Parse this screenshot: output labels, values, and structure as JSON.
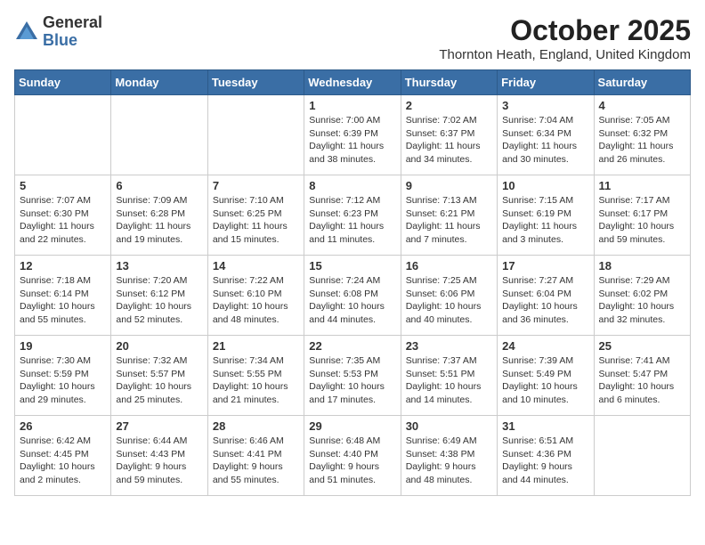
{
  "header": {
    "logo_general": "General",
    "logo_blue": "Blue",
    "month_title": "October 2025",
    "location": "Thornton Heath, England, United Kingdom"
  },
  "days_of_week": [
    "Sunday",
    "Monday",
    "Tuesday",
    "Wednesday",
    "Thursday",
    "Friday",
    "Saturday"
  ],
  "weeks": [
    [
      {
        "day": "",
        "empty": true
      },
      {
        "day": "",
        "empty": true
      },
      {
        "day": "",
        "empty": true
      },
      {
        "day": "1",
        "sunrise": "Sunrise: 7:00 AM",
        "sunset": "Sunset: 6:39 PM",
        "daylight": "Daylight: 11 hours and 38 minutes."
      },
      {
        "day": "2",
        "sunrise": "Sunrise: 7:02 AM",
        "sunset": "Sunset: 6:37 PM",
        "daylight": "Daylight: 11 hours and 34 minutes."
      },
      {
        "day": "3",
        "sunrise": "Sunrise: 7:04 AM",
        "sunset": "Sunset: 6:34 PM",
        "daylight": "Daylight: 11 hours and 30 minutes."
      },
      {
        "day": "4",
        "sunrise": "Sunrise: 7:05 AM",
        "sunset": "Sunset: 6:32 PM",
        "daylight": "Daylight: 11 hours and 26 minutes."
      }
    ],
    [
      {
        "day": "5",
        "sunrise": "Sunrise: 7:07 AM",
        "sunset": "Sunset: 6:30 PM",
        "daylight": "Daylight: 11 hours and 22 minutes."
      },
      {
        "day": "6",
        "sunrise": "Sunrise: 7:09 AM",
        "sunset": "Sunset: 6:28 PM",
        "daylight": "Daylight: 11 hours and 19 minutes."
      },
      {
        "day": "7",
        "sunrise": "Sunrise: 7:10 AM",
        "sunset": "Sunset: 6:25 PM",
        "daylight": "Daylight: 11 hours and 15 minutes."
      },
      {
        "day": "8",
        "sunrise": "Sunrise: 7:12 AM",
        "sunset": "Sunset: 6:23 PM",
        "daylight": "Daylight: 11 hours and 11 minutes."
      },
      {
        "day": "9",
        "sunrise": "Sunrise: 7:13 AM",
        "sunset": "Sunset: 6:21 PM",
        "daylight": "Daylight: 11 hours and 7 minutes."
      },
      {
        "day": "10",
        "sunrise": "Sunrise: 7:15 AM",
        "sunset": "Sunset: 6:19 PM",
        "daylight": "Daylight: 11 hours and 3 minutes."
      },
      {
        "day": "11",
        "sunrise": "Sunrise: 7:17 AM",
        "sunset": "Sunset: 6:17 PM",
        "daylight": "Daylight: 10 hours and 59 minutes."
      }
    ],
    [
      {
        "day": "12",
        "sunrise": "Sunrise: 7:18 AM",
        "sunset": "Sunset: 6:14 PM",
        "daylight": "Daylight: 10 hours and 55 minutes."
      },
      {
        "day": "13",
        "sunrise": "Sunrise: 7:20 AM",
        "sunset": "Sunset: 6:12 PM",
        "daylight": "Daylight: 10 hours and 52 minutes."
      },
      {
        "day": "14",
        "sunrise": "Sunrise: 7:22 AM",
        "sunset": "Sunset: 6:10 PM",
        "daylight": "Daylight: 10 hours and 48 minutes."
      },
      {
        "day": "15",
        "sunrise": "Sunrise: 7:24 AM",
        "sunset": "Sunset: 6:08 PM",
        "daylight": "Daylight: 10 hours and 44 minutes."
      },
      {
        "day": "16",
        "sunrise": "Sunrise: 7:25 AM",
        "sunset": "Sunset: 6:06 PM",
        "daylight": "Daylight: 10 hours and 40 minutes."
      },
      {
        "day": "17",
        "sunrise": "Sunrise: 7:27 AM",
        "sunset": "Sunset: 6:04 PM",
        "daylight": "Daylight: 10 hours and 36 minutes."
      },
      {
        "day": "18",
        "sunrise": "Sunrise: 7:29 AM",
        "sunset": "Sunset: 6:02 PM",
        "daylight": "Daylight: 10 hours and 32 minutes."
      }
    ],
    [
      {
        "day": "19",
        "sunrise": "Sunrise: 7:30 AM",
        "sunset": "Sunset: 5:59 PM",
        "daylight": "Daylight: 10 hours and 29 minutes."
      },
      {
        "day": "20",
        "sunrise": "Sunrise: 7:32 AM",
        "sunset": "Sunset: 5:57 PM",
        "daylight": "Daylight: 10 hours and 25 minutes."
      },
      {
        "day": "21",
        "sunrise": "Sunrise: 7:34 AM",
        "sunset": "Sunset: 5:55 PM",
        "daylight": "Daylight: 10 hours and 21 minutes."
      },
      {
        "day": "22",
        "sunrise": "Sunrise: 7:35 AM",
        "sunset": "Sunset: 5:53 PM",
        "daylight": "Daylight: 10 hours and 17 minutes."
      },
      {
        "day": "23",
        "sunrise": "Sunrise: 7:37 AM",
        "sunset": "Sunset: 5:51 PM",
        "daylight": "Daylight: 10 hours and 14 minutes."
      },
      {
        "day": "24",
        "sunrise": "Sunrise: 7:39 AM",
        "sunset": "Sunset: 5:49 PM",
        "daylight": "Daylight: 10 hours and 10 minutes."
      },
      {
        "day": "25",
        "sunrise": "Sunrise: 7:41 AM",
        "sunset": "Sunset: 5:47 PM",
        "daylight": "Daylight: 10 hours and 6 minutes."
      }
    ],
    [
      {
        "day": "26",
        "sunrise": "Sunrise: 6:42 AM",
        "sunset": "Sunset: 4:45 PM",
        "daylight": "Daylight: 10 hours and 2 minutes."
      },
      {
        "day": "27",
        "sunrise": "Sunrise: 6:44 AM",
        "sunset": "Sunset: 4:43 PM",
        "daylight": "Daylight: 9 hours and 59 minutes."
      },
      {
        "day": "28",
        "sunrise": "Sunrise: 6:46 AM",
        "sunset": "Sunset: 4:41 PM",
        "daylight": "Daylight: 9 hours and 55 minutes."
      },
      {
        "day": "29",
        "sunrise": "Sunrise: 6:48 AM",
        "sunset": "Sunset: 4:40 PM",
        "daylight": "Daylight: 9 hours and 51 minutes."
      },
      {
        "day": "30",
        "sunrise": "Sunrise: 6:49 AM",
        "sunset": "Sunset: 4:38 PM",
        "daylight": "Daylight: 9 hours and 48 minutes."
      },
      {
        "day": "31",
        "sunrise": "Sunrise: 6:51 AM",
        "sunset": "Sunset: 4:36 PM",
        "daylight": "Daylight: 9 hours and 44 minutes."
      },
      {
        "day": "",
        "empty": true
      }
    ]
  ]
}
